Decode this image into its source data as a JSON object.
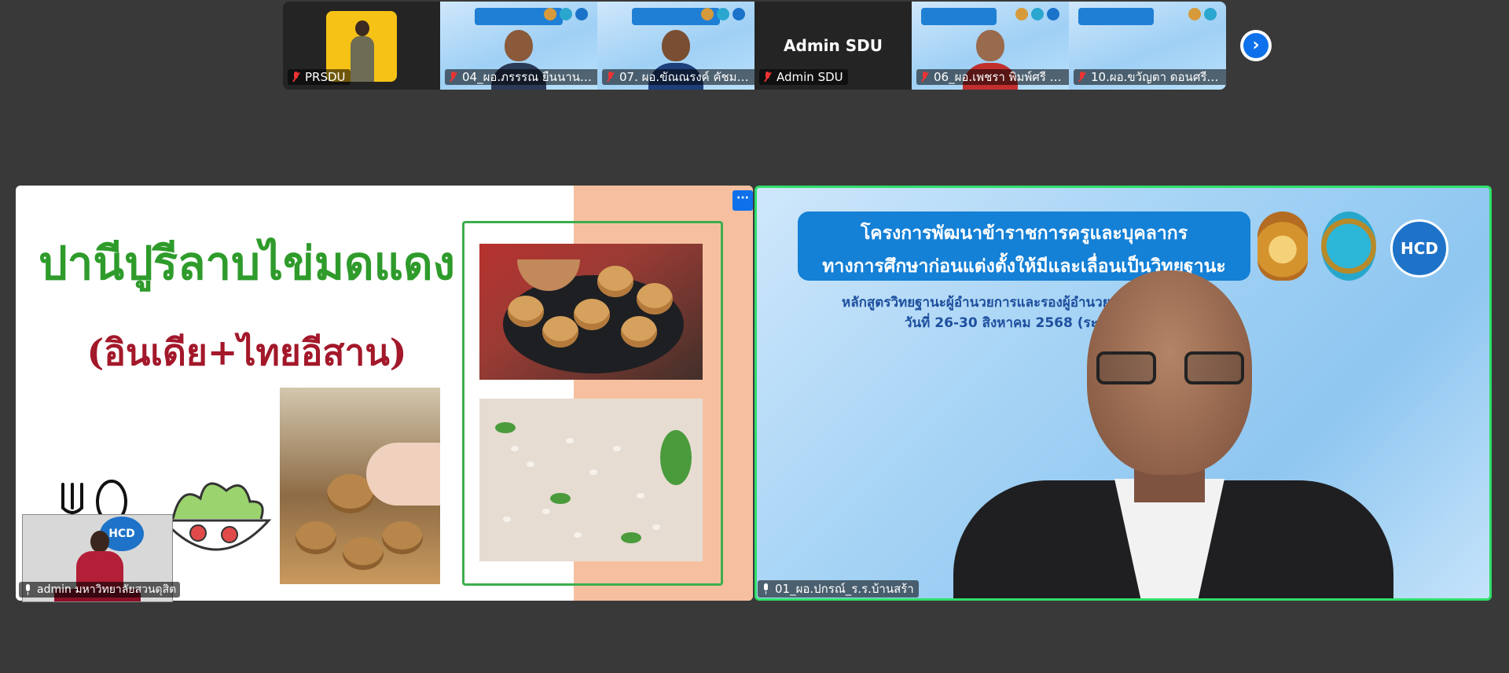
{
  "thumbnails": [
    {
      "name": "PRSDU",
      "mic": "off",
      "video": "yellow"
    },
    {
      "name": "04_ผอ.ภรรรณ ยืนนาน_...",
      "mic": "off",
      "video": "person"
    },
    {
      "name": "07. ผอ.ขัณณรงค์ คัชมาตย์...",
      "mic": "off",
      "video": "person"
    },
    {
      "name": "Admin SDU",
      "mic": "off",
      "video": "text",
      "display_title": "Admin SDU"
    },
    {
      "name": "06_ผอ.เพชรา พิมพ์ศรี ร.ร...",
      "mic": "off",
      "video": "person"
    },
    {
      "name": "10.ผอ.ขวัญตา ดอนศรีจัน...",
      "mic": "off",
      "video": "person"
    }
  ],
  "next_page_icon": "chevron-right-icon",
  "shared_screen": {
    "title": "ปานีปูรีลาบไข่มดแดง",
    "subtitle": "(อินเดีย+ไทยอีสาน)",
    "more_label": "···"
  },
  "self_view": {
    "name": "admin มหาวิทยาลัยสวนดุสิต",
    "logo_text": "HCD"
  },
  "active_speaker": {
    "name": "01_ผอ.ปกรณ์_ร.ร.บ้านสร้า",
    "banner_line1": "โครงการพัฒนาข้าราชการครูและบุคลากร",
    "banner_line2": "ทางการศึกษาก่อนแต่งตั้งให้มีและเลื่อนเป็นวิทยฐานะ",
    "line3": "หลักสูตรวิทยฐานะผู้อำนวยการและรองผู้อำนวย",
    "line4": "วันที่ 26-30 สิงหาคม 2568 (ระย",
    "logo_text": "HCD"
  },
  "colors": {
    "background": "#393939",
    "active_border": "#2ee06a",
    "zoom_blue": "#0e71eb",
    "title_green": "#2e9b2a",
    "subtitle_red": "#a3182a"
  }
}
